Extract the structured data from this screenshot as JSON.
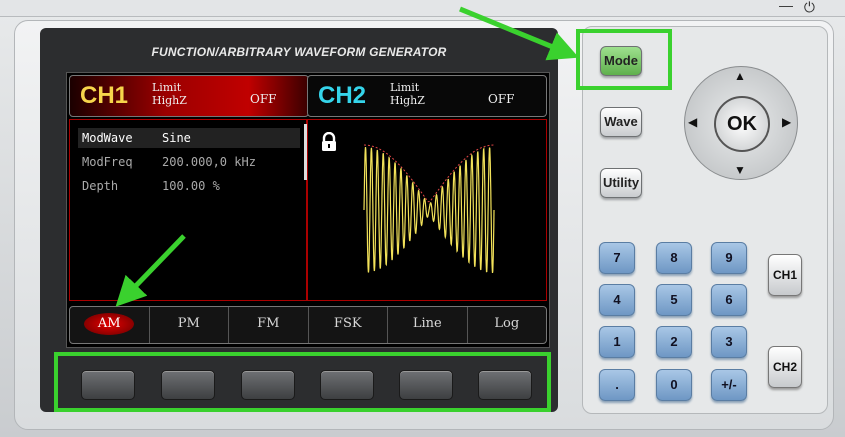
{
  "device": {
    "title": "FUNCTION/ARBITRARY WAVEFORM GENERATOR"
  },
  "screen": {
    "ch1": {
      "name": "CH1",
      "limit_label": "Limit",
      "impedance": "HighZ",
      "state": "OFF"
    },
    "ch2": {
      "name": "CH2",
      "limit_label": "Limit",
      "impedance": "HighZ",
      "state": "OFF"
    },
    "params": [
      {
        "key": "ModWave",
        "value": "Sine",
        "active": true
      },
      {
        "key": "ModFreq",
        "value": "200.000,0 kHz",
        "active": false
      },
      {
        "key": "Depth",
        "value": "100.00 %",
        "active": false
      }
    ],
    "softkeys": [
      "AM",
      "PM",
      "FM",
      "FSK",
      "Line",
      "Log"
    ],
    "active_softkey": "AM",
    "lock_icon": "lock-icon"
  },
  "buttons": {
    "mode": "Mode",
    "wave": "Wave",
    "utility": "Utility",
    "ok": "OK",
    "ch1": "CH1",
    "ch2": "CH2"
  },
  "keypad": [
    [
      "7",
      "8",
      "9"
    ],
    [
      "4",
      "5",
      "6"
    ],
    [
      "1",
      "2",
      "3"
    ],
    [
      ".",
      "0",
      "+/-"
    ]
  ],
  "colors": {
    "ch1_name": "#f6d54b",
    "ch2_name": "#35d4ea",
    "highlight": "#3ad12e",
    "waveform": "#f2e25a",
    "active_softkey": "#e40000"
  }
}
